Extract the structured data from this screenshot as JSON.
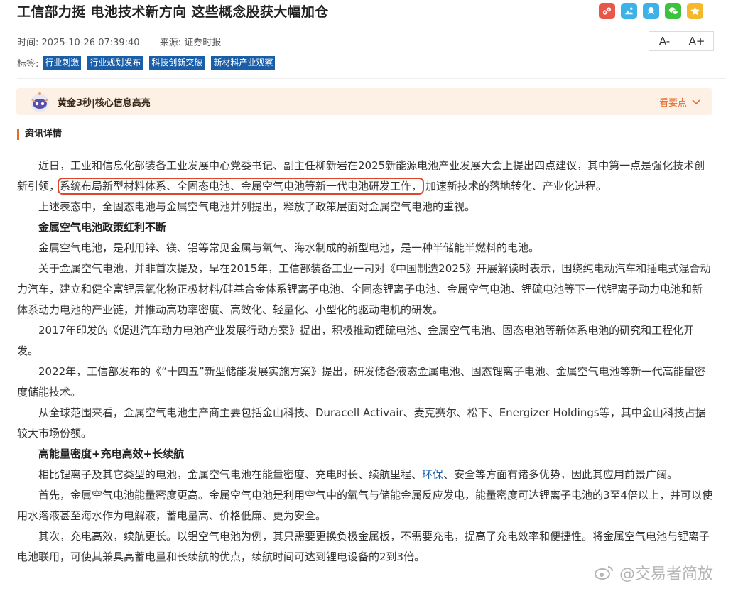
{
  "article": {
    "title": "工信部力挺 电池技术新方向 这些概念股获大幅加仓",
    "time": "时间:  2025-10-26 07:39:40",
    "source": "来源:  证券时报",
    "tags_label": "标签:",
    "tags": [
      "行业刺激",
      "行业规划发布",
      "科技创新突破",
      "新材料产业观察"
    ],
    "font_decrease": "A-",
    "font_increase": "A+"
  },
  "share_icons": [
    {
      "name": "link-icon",
      "color": "#e8574a"
    },
    {
      "name": "qzone-icon",
      "color": "#3cb2e8"
    },
    {
      "name": "qq-icon",
      "color": "#3cb2e8"
    },
    {
      "name": "wechat-icon",
      "color": "#3cc23c"
    },
    {
      "name": "favorite-icon",
      "color": "#f5b82a"
    }
  ],
  "banner": {
    "title": "黄金3秒|核心信息高亮",
    "more": "看要点"
  },
  "section": {
    "title": "资讯详情"
  },
  "body": {
    "p1_a": "近日，工业和信息化部装备工业发展中心党委书记、副主任柳新岩在2025新能源电池产业发展大会上提出四点建议，其中第一点是强化技术创新引领，",
    "p1_hl": "系统布局新型材料体系、全固态电池、金属空气电池等新一代电池研发工作，",
    "p1_b": "加速新技术的落地转化、产业化进程。",
    "p2": "上述表态中，全固态电池与金属空气电池并列提出，释放了政策层面对金属空气电池的重视。",
    "h1": "金属空气电池政策红利不断",
    "p3": "金属空气电池，是利用锌、镁、铝等常见金属与氧气、海水制成的新型电池，是一种半储能半燃料的电池。",
    "p4": "关于金属空气电池，并非首次提及，早在2015年，工信部装备工业一司对《中国制造2025》开展解读时表示，围绕纯电动汽车和插电式混合动力汽车，建立和健全富锂层氧化物正极材料/硅基合金体系锂离子电池、全固态锂离子电池、金属空气电池、锂硫电池等下一代锂离子动力电池和新体系动力电池的产业链，并推动高功率密度、高效化、轻量化、小型化的驱动电机的研发。",
    "p5": "2017年印发的《促进汽车动力电池产业发展行动方案》提出，积极推动锂硫电池、金属空气电池、固态电池等新体系电池的研究和工程化开发。",
    "p6": "2022年，工信部发布的《“十四五”新型储能发展实施方案》提出，研发储备液态金属电池、固态锂离子电池、金属空气电池等新一代高能量密度储能技术。",
    "p7": "从全球范围来看，金属空气电池生产商主要包括金山科技、Duracell Activair、麦克赛尔、松下、Energizer Holdings等，其中金山科技占据较大市场份额。",
    "h2": "高能量密度+充电高效+长续航",
    "p8_a": "相比锂离子及其它类型的电池，金属空气电池在能量密度、充电时长、续航里程、",
    "p8_link": "环保",
    "p8_b": "、安全等方面有诸多优势，因此其应用前景广阔。",
    "p9": "首先，金属空气电池能量密度更高。金属空气电池是利用空气中的氧气与储能金属反应发电，能量密度可达锂离子电池的3至4倍以上，并可以使用水溶液甚至海水作为电解液，蓄电量高、价格低廉、更为安全。",
    "p10": "其次，充电高效，续航更长。以铝空气电池为例，其只需要更换负极金属板，不需要充电，提高了充电效率和便捷性。将金属空气电池与锂离子电池联用，可使其兼具高蓄电量和长续航的优点，续航时间可达到锂电设备的2到3倍。"
  },
  "watermark": {
    "text": "@交易者简放"
  }
}
